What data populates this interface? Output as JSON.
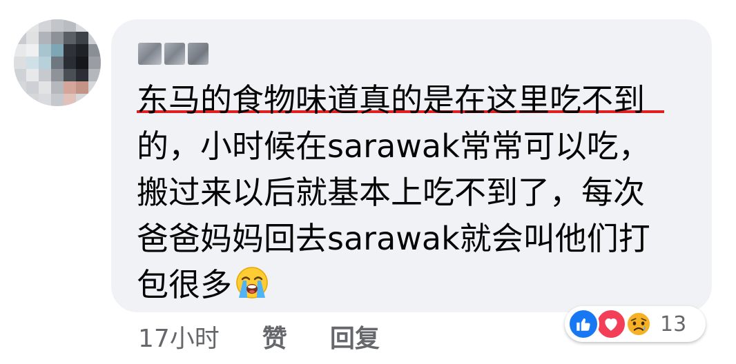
{
  "comment": {
    "lines": [
      "东马的食物味道真的是在这里吃不到",
      "的，小时候在sarawak常常可以吃，",
      "搬过来以后就基本上吃不到了，每次",
      "爸爸妈妈回去sarawak就会叫他们打",
      "包很多"
    ],
    "trailing_emoji": "loudly-crying-face-emoji",
    "underline_color": "#e02020"
  },
  "actions": {
    "time": "17小时",
    "like_label": "赞",
    "reply_label": "回复"
  },
  "reactions": {
    "icons": [
      "like-icon",
      "love-icon",
      "sad-icon"
    ],
    "count": "13",
    "colors": {
      "like": "#1877f2",
      "love": "#f33e58",
      "sad": "#f7b125"
    }
  },
  "colors": {
    "bubble": "#f0f2f5",
    "text": "#050505",
    "secondary_text": "#65676b"
  }
}
